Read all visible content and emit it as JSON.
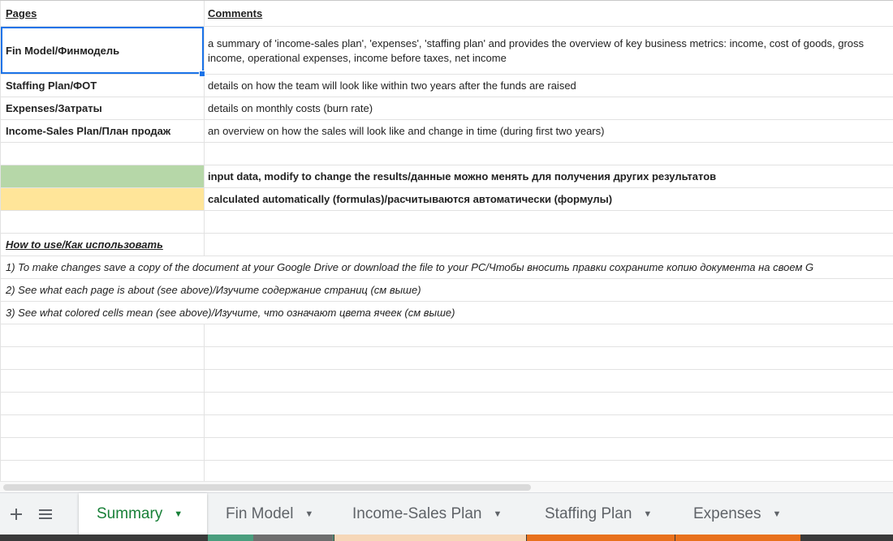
{
  "sheet": {
    "header": {
      "pages": "Pages",
      "comments": "Comments"
    },
    "rows": [
      {
        "page": "Fin Model/Финмодель",
        "comment": "a summary of 'income-sales plan', 'expenses', 'staffing plan' and provides the overview of key business metrics: income, cost of goods, gross income, operational expenses, income before taxes, net income"
      },
      {
        "page": "Staffing Plan/ФОТ",
        "comment": "details on how the team will look like within two years after the funds are raised"
      },
      {
        "page": "Expenses/Затраты",
        "comment": "details on monthly costs (burn rate)"
      },
      {
        "page": "Income-Sales Plan/План продаж",
        "comment": "an overview on how the sales will look like and change in time (during first two years)"
      }
    ],
    "legend": {
      "green_color": "#b6d7a8",
      "green_text": "input data, modify to change the results/данные можно менять для получения других результатов",
      "yellow_color": "#ffe599",
      "yellow_text": "calculated automatically (formulas)/расчитываются автоматически (формулы)"
    },
    "howto": {
      "title": "How to use/Как использовать",
      "steps": [
        "1) To make changes save a copy of the document at your Google Drive or download the file to your PC/Чтобы вносить правки сохраните копию документа на своем G",
        "2) See what each page is about (see above)/Изучите содержание страниц (см выше)",
        "3) See what colored cells mean (see above)/Изучите, что означают цвета ячеек (см выше)"
      ]
    }
  },
  "tabs": {
    "add_icon": "plus-icon",
    "list_icon": "menu-icon",
    "items": [
      {
        "label": "Summary",
        "active": true,
        "color": ""
      },
      {
        "label": "Fin Model",
        "active": false,
        "color": "#4a9e7e"
      },
      {
        "label": "Income-Sales Plan",
        "active": false,
        "color": "#f6d7b8"
      },
      {
        "label": "Staffing Plan",
        "active": false,
        "color": "#e8711c"
      },
      {
        "label": "Expenses",
        "active": false,
        "color": "#e8711c"
      }
    ]
  },
  "colors": {
    "accent": "#188038",
    "selection": "#1a73e8"
  }
}
